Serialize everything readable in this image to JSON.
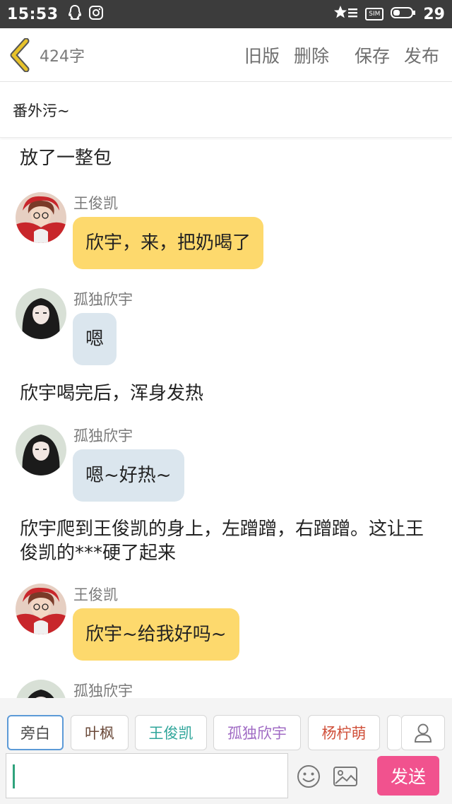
{
  "status_bar": {
    "time": "15:53",
    "battery": "29",
    "sim_label": "SIM"
  },
  "nav": {
    "word_count": "424字",
    "actions": [
      "旧版",
      "删除",
      "保存",
      "发布"
    ]
  },
  "title": "番外污~",
  "story": [
    {
      "type": "narration",
      "text": "放了一整包"
    },
    {
      "type": "message",
      "sender": "王俊凯",
      "text": "欣宇，来，把奶喝了",
      "bubble_color": "#fdd96d"
    },
    {
      "type": "message",
      "sender": "孤独欣宇",
      "text": "嗯",
      "bubble_color": "#dbe6ee"
    },
    {
      "type": "narration",
      "text": "欣宇喝完后，浑身发热"
    },
    {
      "type": "message",
      "sender": "孤独欣宇",
      "text": "嗯~好热~",
      "bubble_color": "#dbe6ee"
    },
    {
      "type": "narration",
      "text": "欣宇爬到王俊凯的身上，左蹭蹭，右蹭蹭。这让王俊凯的***硬了起来"
    },
    {
      "type": "message",
      "sender": "王俊凯",
      "text": "欣宇~给我好吗~",
      "bubble_color": "#fdd96d"
    },
    {
      "type": "message",
      "sender": "孤独欣宇",
      "text": ""
    }
  ],
  "characters": [
    {
      "name": "旁白",
      "color": "#4a4a4a",
      "active": true
    },
    {
      "name": "叶枫",
      "color": "#6b4a3a",
      "active": false
    },
    {
      "name": "王俊凯",
      "color": "#2ea59a",
      "active": false
    },
    {
      "name": "孤独欣宇",
      "color": "#a06bc4",
      "active": false
    },
    {
      "name": "杨柠萌",
      "color": "#d0503a",
      "active": false
    }
  ],
  "input": {
    "value": "",
    "send_label": "发送"
  },
  "colors": {
    "accent_yellow": "#fdd96d",
    "bubble_blue": "#dbe6ee",
    "send_pink": "#f1528e",
    "back_arrow": "#e7c22a"
  },
  "icons": [
    "qq-icon",
    "instagram-icon",
    "star-signal-icon",
    "battery-icon",
    "back-arrow-icon",
    "user-manage-icon",
    "emoji-icon",
    "image-icon"
  ]
}
